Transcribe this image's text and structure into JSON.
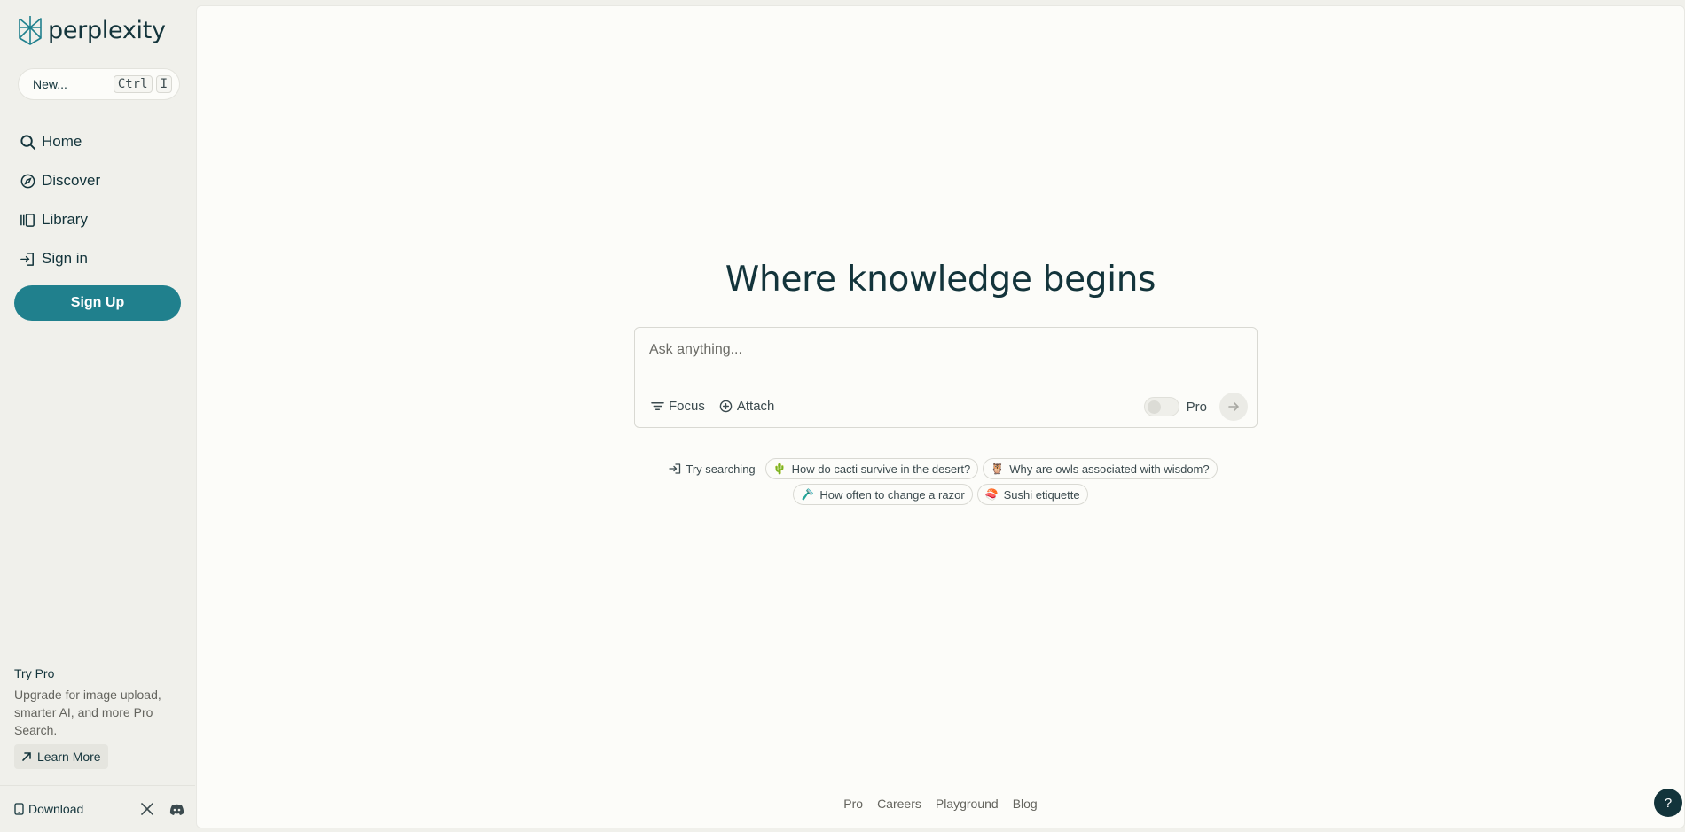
{
  "brand": {
    "name": "perplexity",
    "accent": "#20808d",
    "dark": "#13343b"
  },
  "sidebar": {
    "new_thread": {
      "label": "New...",
      "shortcut_key1": "Ctrl",
      "shortcut_key2": "I"
    },
    "items": [
      {
        "label": "Home",
        "icon": "search-icon"
      },
      {
        "label": "Discover",
        "icon": "compass-icon"
      },
      {
        "label": "Library",
        "icon": "library-icon"
      },
      {
        "label": "Sign in",
        "icon": "sign-in-icon"
      }
    ],
    "signup_label": "Sign Up",
    "try_pro": {
      "title": "Try Pro",
      "description": "Upgrade for image upload, smarter AI, and more Pro Search.",
      "learn_more": "Learn More"
    },
    "footer": {
      "download": "Download",
      "social": [
        "x-icon",
        "discord-icon"
      ]
    }
  },
  "main": {
    "headline": "Where knowledge begins",
    "search": {
      "placeholder": "Ask anything...",
      "focus_label": "Focus",
      "attach_label": "Attach",
      "pro_label": "Pro",
      "pro_enabled": false
    },
    "suggestions": {
      "label": "Try searching",
      "items": [
        {
          "emoji": "🌵",
          "text": "How do cacti survive in the desert?"
        },
        {
          "emoji": "🦉",
          "text": "Why are owls associated with wisdom?"
        },
        {
          "emoji": "🪒",
          "text": "How often to change a razor"
        },
        {
          "emoji": "🍣",
          "text": "Sushi etiquette"
        }
      ]
    },
    "footer_links": [
      "Pro",
      "Careers",
      "Playground",
      "Blog"
    ],
    "help_label": "?"
  }
}
